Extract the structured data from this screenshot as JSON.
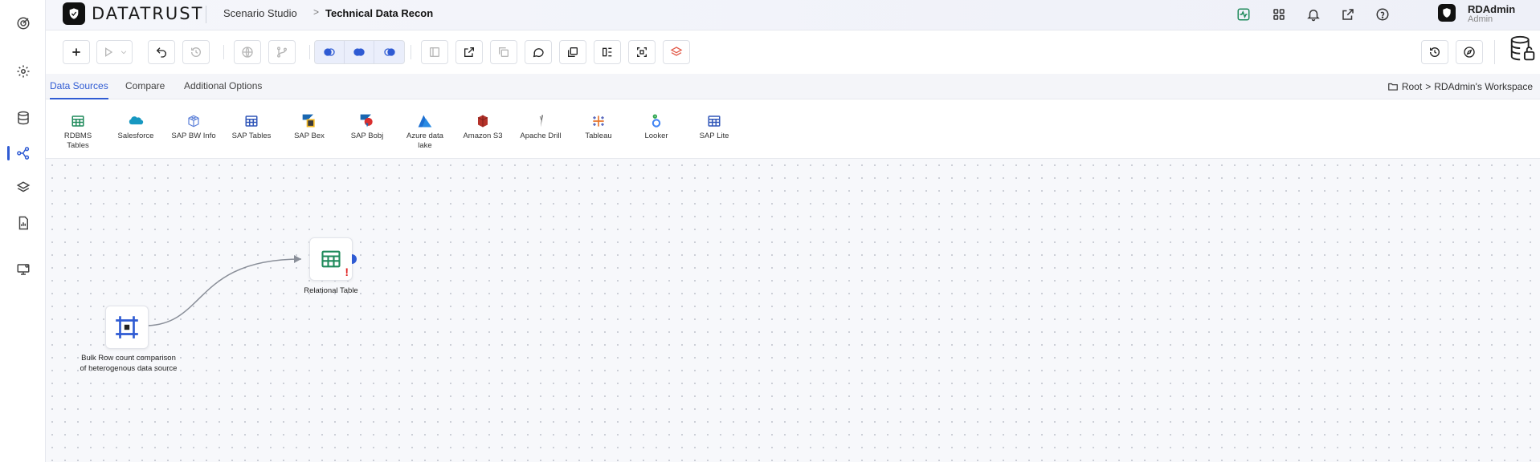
{
  "app": {
    "brand": "DATATRUST",
    "breadcrumb": {
      "studio": "Scenario Studio",
      "separator": ">",
      "current": "Technical Data Recon"
    },
    "user": {
      "name": "RDAdmin",
      "role": "Admin"
    }
  },
  "rail": {
    "items": [
      {
        "name": "dashboard",
        "icon": "target-icon"
      },
      {
        "name": "settings",
        "icon": "gear-icon"
      },
      {
        "name": "data",
        "icon": "database-icon"
      },
      {
        "name": "scenarios",
        "icon": "flow-icon",
        "active": true
      },
      {
        "name": "layers",
        "icon": "layers-icon"
      },
      {
        "name": "reports",
        "icon": "report-icon"
      },
      {
        "name": "monitor",
        "icon": "monitor-icon"
      }
    ]
  },
  "tabs": [
    {
      "label": "Data Sources",
      "active": true
    },
    {
      "label": "Compare",
      "active": false
    },
    {
      "label": "Additional Options",
      "active": false
    }
  ],
  "workspace_path": {
    "root": "Root",
    "separator": ">",
    "workspace": "RDAdmin's Workspace"
  },
  "sources": [
    {
      "label": "RDBMS Tables",
      "icon": "table-icon",
      "color": "#1f8a5b"
    },
    {
      "label": "Salesforce",
      "icon": "salesforce-icon",
      "color": "#1798c1"
    },
    {
      "label": "SAP BW Info",
      "icon": "cube-icon",
      "color": "#5b7fd8"
    },
    {
      "label": "SAP Tables",
      "icon": "table-icon",
      "color": "#3056b8"
    },
    {
      "label": "SAP Bex",
      "icon": "sap-bex-icon",
      "color": "#1a67b0"
    },
    {
      "label": "SAP Bobj",
      "icon": "sap-bobj-icon",
      "color": "#d92f2f"
    },
    {
      "label": "Azure data lake",
      "icon": "azure-icon",
      "color": "#1c6fd1"
    },
    {
      "label": "Amazon S3",
      "icon": "s3-icon",
      "color": "#b5322a"
    },
    {
      "label": "Apache Drill",
      "icon": "drill-icon",
      "color": "#555555"
    },
    {
      "label": "Tableau",
      "icon": "tableau-icon",
      "color": "#e8762c"
    },
    {
      "label": "Looker",
      "icon": "looker-icon",
      "color": "#4285f4"
    },
    {
      "label": "SAP Lite",
      "icon": "table-icon",
      "color": "#3056b8"
    }
  ],
  "nodes": {
    "compare": {
      "label": "Bulk Row count comparison of heterogenous data source",
      "icon": "compare-frame-icon"
    },
    "relational": {
      "label": "Relational Table",
      "icon": "table-icon",
      "warning": "!"
    }
  },
  "colors": {
    "accent": "#2f5bd3",
    "toolbar_group_bg": "#eaeefb",
    "warning": "#e02424",
    "table_green": "#1f8a5b"
  }
}
